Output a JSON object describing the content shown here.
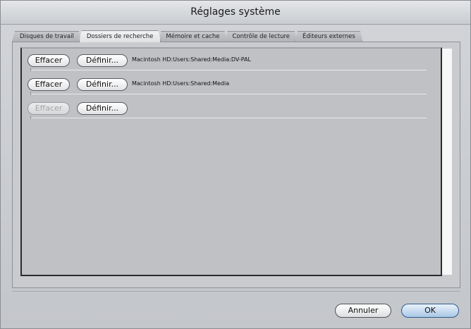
{
  "window": {
    "title": "Réglages système"
  },
  "tabs": [
    {
      "label": "Disques de travail",
      "active": false
    },
    {
      "label": "Dossiers de recherche",
      "active": true
    },
    {
      "label": "Mémoire et cache",
      "active": false
    },
    {
      "label": "Contrôle de lecture",
      "active": false
    },
    {
      "label": "Éditeurs externes",
      "active": false
    }
  ],
  "rows": [
    {
      "clear_label": "Effacer",
      "set_label": "Définir...",
      "path": "Macintosh HD:Users:Shared:Media:DV-PAL",
      "clear_enabled": true
    },
    {
      "clear_label": "Effacer",
      "set_label": "Définir...",
      "path": "Macintosh HD:Users:Shared:Media",
      "clear_enabled": true
    },
    {
      "clear_label": "Effacer",
      "set_label": "Définir...",
      "path": "",
      "clear_enabled": false
    }
  ],
  "footer": {
    "cancel_label": "Annuler",
    "ok_label": "OK"
  },
  "colors": {
    "default_button": "#a9c7e6",
    "panel_bg": "#bfc1c5"
  }
}
